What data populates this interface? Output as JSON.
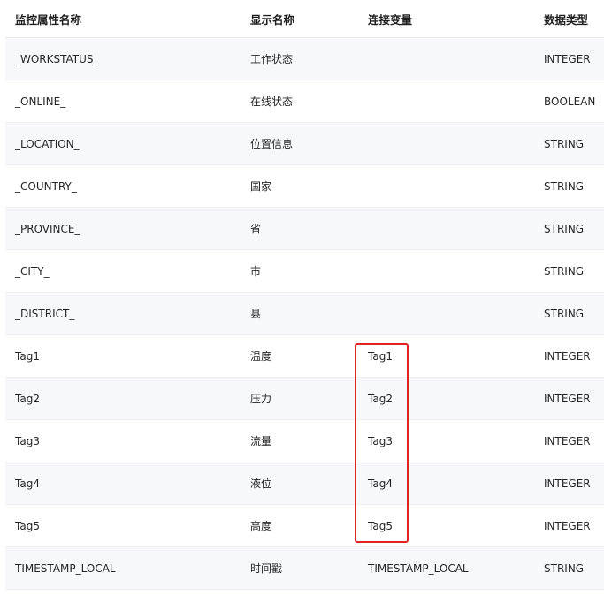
{
  "columns": [
    "监控属性名称",
    "显示名称",
    "连接变量",
    "数据类型"
  ],
  "rows": [
    [
      "_WORKSTATUS_",
      "工作状态",
      "",
      "INTEGER"
    ],
    [
      "_ONLINE_",
      "在线状态",
      "",
      "BOOLEAN"
    ],
    [
      "_LOCATION_",
      "位置信息",
      "",
      "STRING"
    ],
    [
      "_COUNTRY_",
      "国家",
      "",
      "STRING"
    ],
    [
      "_PROVINCE_",
      "省",
      "",
      "STRING"
    ],
    [
      "_CITY_",
      "市",
      "",
      "STRING"
    ],
    [
      "_DISTRICT_",
      "县",
      "",
      "STRING"
    ],
    [
      "Tag1",
      "温度",
      "Tag1",
      "INTEGER"
    ],
    [
      "Tag2",
      "压力",
      "Tag2",
      "INTEGER"
    ],
    [
      "Tag3",
      "流量",
      "Tag3",
      "INTEGER"
    ],
    [
      "Tag4",
      "液位",
      "Tag4",
      "INTEGER"
    ],
    [
      "Tag5",
      "高度",
      "Tag5",
      "INTEGER"
    ],
    [
      "TIMESTAMP_LOCAL",
      "时间戳",
      "TIMESTAMP_LOCAL",
      "STRING"
    ]
  ],
  "colors": {
    "highlight_border": "#e02424",
    "row_alt": "#f7f8fa"
  }
}
